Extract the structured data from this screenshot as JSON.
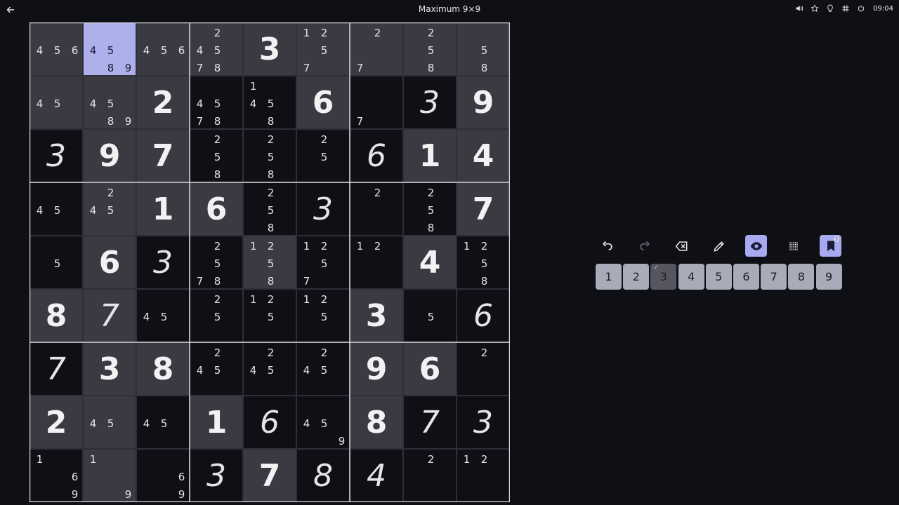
{
  "header": {
    "title": "Maximum 9×9",
    "clock": "09:04"
  },
  "toolbar": {
    "notes_badge": "5"
  },
  "numpad": {
    "keys": [
      "1",
      "2",
      "3",
      "4",
      "5",
      "6",
      "7",
      "8",
      "9"
    ],
    "completed": [
      "3"
    ],
    "check_mark": "✓"
  },
  "board": {
    "selected": [
      0,
      1
    ],
    "cells": [
      [
        {
          "type": "cand",
          "notes": [
            4,
            5,
            6
          ]
        },
        {
          "type": "cand",
          "notes": [
            4,
            5,
            8,
            9
          ]
        },
        {
          "type": "cand",
          "notes": [
            4,
            5,
            6
          ]
        },
        {
          "type": "cand",
          "notes": [
            2,
            4,
            5,
            7,
            8
          ]
        },
        {
          "type": "given",
          "value": "3"
        },
        {
          "type": "cand",
          "notes": [
            1,
            2,
            5,
            7
          ]
        },
        {
          "type": "cand",
          "notes": [
            2,
            7
          ]
        },
        {
          "type": "cand",
          "notes": [
            2,
            5,
            8
          ]
        },
        {
          "type": "cand",
          "notes": [
            5,
            8
          ]
        }
      ],
      [
        {
          "type": "cand",
          "notes": [
            4,
            5
          ]
        },
        {
          "type": "cand",
          "notes": [
            4,
            5,
            8,
            9
          ]
        },
        {
          "type": "given",
          "value": "2"
        },
        {
          "type": "cand",
          "notes": [
            4,
            5,
            7,
            8
          ]
        },
        {
          "type": "cand",
          "notes": [
            1,
            4,
            5,
            8
          ]
        },
        {
          "type": "given",
          "value": "6"
        },
        {
          "type": "cand",
          "notes": [
            7
          ]
        },
        {
          "type": "user",
          "value": "3"
        },
        {
          "type": "given",
          "value": "9"
        }
      ],
      [
        {
          "type": "user",
          "value": "3"
        },
        {
          "type": "given",
          "value": "9"
        },
        {
          "type": "given",
          "value": "7"
        },
        {
          "type": "cand",
          "notes": [
            2,
            5,
            8
          ]
        },
        {
          "type": "cand",
          "notes": [
            2,
            5,
            8
          ]
        },
        {
          "type": "cand",
          "notes": [
            2,
            5
          ]
        },
        {
          "type": "user",
          "value": "6"
        },
        {
          "type": "given",
          "value": "1"
        },
        {
          "type": "given",
          "value": "4"
        }
      ],
      [
        {
          "type": "cand",
          "notes": [
            4,
            5
          ]
        },
        {
          "type": "cand",
          "notes": [
            2,
            4,
            5
          ]
        },
        {
          "type": "given",
          "value": "1"
        },
        {
          "type": "given",
          "value": "6"
        },
        {
          "type": "cand",
          "notes": [
            2,
            5,
            8
          ]
        },
        {
          "type": "user",
          "value": "3"
        },
        {
          "type": "cand",
          "notes": [
            2
          ]
        },
        {
          "type": "cand",
          "notes": [
            2,
            5,
            8
          ]
        },
        {
          "type": "given",
          "value": "7"
        }
      ],
      [
        {
          "type": "cand",
          "notes": [
            5
          ]
        },
        {
          "type": "given",
          "value": "6"
        },
        {
          "type": "user",
          "value": "3"
        },
        {
          "type": "cand",
          "notes": [
            2,
            5,
            7,
            8
          ]
        },
        {
          "type": "cand",
          "notes": [
            1,
            2,
            5,
            8
          ]
        },
        {
          "type": "cand",
          "notes": [
            1,
            2,
            5,
            7
          ]
        },
        {
          "type": "cand",
          "notes": [
            1,
            2
          ]
        },
        {
          "type": "given",
          "value": "4"
        },
        {
          "type": "cand",
          "notes": [
            1,
            2,
            5,
            8
          ]
        }
      ],
      [
        {
          "type": "given",
          "value": "8"
        },
        {
          "type": "user",
          "value": "7",
          "dim": true
        },
        {
          "type": "cand",
          "notes": [
            4,
            5
          ]
        },
        {
          "type": "cand",
          "notes": [
            2,
            5
          ]
        },
        {
          "type": "cand",
          "notes": [
            1,
            2,
            5
          ]
        },
        {
          "type": "cand",
          "notes": [
            1,
            2,
            5
          ]
        },
        {
          "type": "given",
          "value": "3"
        },
        {
          "type": "cand",
          "notes": [
            5
          ]
        },
        {
          "type": "user",
          "value": "6"
        }
      ],
      [
        {
          "type": "user",
          "value": "7"
        },
        {
          "type": "given",
          "value": "3"
        },
        {
          "type": "given",
          "value": "8"
        },
        {
          "type": "cand",
          "notes": [
            2,
            4,
            5
          ]
        },
        {
          "type": "cand",
          "notes": [
            2,
            4,
            5
          ]
        },
        {
          "type": "cand",
          "notes": [
            2,
            4,
            5
          ]
        },
        {
          "type": "given",
          "value": "9"
        },
        {
          "type": "given",
          "value": "6"
        },
        {
          "type": "cand",
          "notes": [
            2
          ]
        }
      ],
      [
        {
          "type": "given",
          "value": "2"
        },
        {
          "type": "cand",
          "notes": [
            4,
            5
          ],
          "dim": true
        },
        {
          "type": "cand",
          "notes": [
            4,
            5
          ]
        },
        {
          "type": "given",
          "value": "1"
        },
        {
          "type": "user",
          "value": "6"
        },
        {
          "type": "cand",
          "notes": [
            4,
            5,
            9
          ]
        },
        {
          "type": "given",
          "value": "8"
        },
        {
          "type": "user",
          "value": "7"
        },
        {
          "type": "user",
          "value": "3"
        }
      ],
      [
        {
          "type": "cand",
          "notes": [
            1,
            6,
            9
          ]
        },
        {
          "type": "cand",
          "notes": [
            1,
            9
          ],
          "dim": true
        },
        {
          "type": "cand",
          "notes": [
            6,
            9
          ]
        },
        {
          "type": "user",
          "value": "3"
        },
        {
          "type": "given",
          "value": "7"
        },
        {
          "type": "user",
          "value": "8"
        },
        {
          "type": "user",
          "value": "4"
        },
        {
          "type": "cand",
          "notes": [
            2
          ]
        },
        {
          "type": "cand",
          "notes": [
            1,
            2
          ]
        }
      ]
    ]
  }
}
